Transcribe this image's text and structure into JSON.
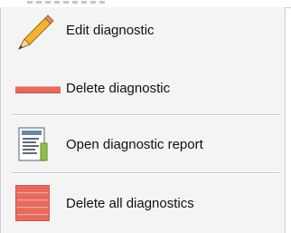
{
  "menu": {
    "items": [
      {
        "label": "Edit diagnostic",
        "icon": "pencil-icon"
      },
      {
        "label": "Delete diagnostic",
        "icon": "red-bar-icon"
      },
      {
        "label": "Open diagnostic report",
        "icon": "report-document-icon"
      },
      {
        "label": "Delete all diagnostics",
        "icon": "red-grid-icon"
      }
    ]
  },
  "colors": {
    "menu_background": "#f4f4f4",
    "separator": "#c9c9c9",
    "delete_red": "#e66a5d",
    "pencil_yellow": "#f2b233"
  }
}
